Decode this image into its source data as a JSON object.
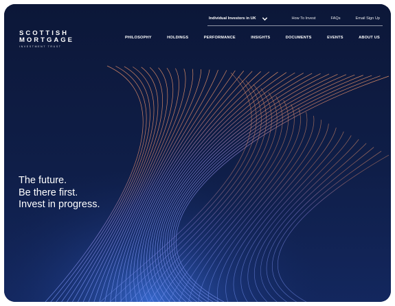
{
  "logo": {
    "line1": "SCOTTISH",
    "line2": "MORTGAGE",
    "line3": "INVESTMENT TRUST"
  },
  "utility_nav": {
    "investor_type": "Individual Investors in UK",
    "links": [
      "How To Invest",
      "FAQs",
      "Email Sign Up"
    ]
  },
  "main_nav": {
    "items": [
      "PHILOSOPHY",
      "HOLDINGS",
      "PERFORMANCE",
      "INSIGHTS",
      "DOCUMENTS",
      "EVENTS",
      "ABOUT US"
    ]
  },
  "hero": {
    "line1": "The future.",
    "line2": "Be there first.",
    "line3": "Invest in progress."
  },
  "colors": {
    "background": "#0d1a3d",
    "text": "#ffffff",
    "accent_orange": "#e8895a",
    "accent_blue": "#3a6fd8"
  }
}
